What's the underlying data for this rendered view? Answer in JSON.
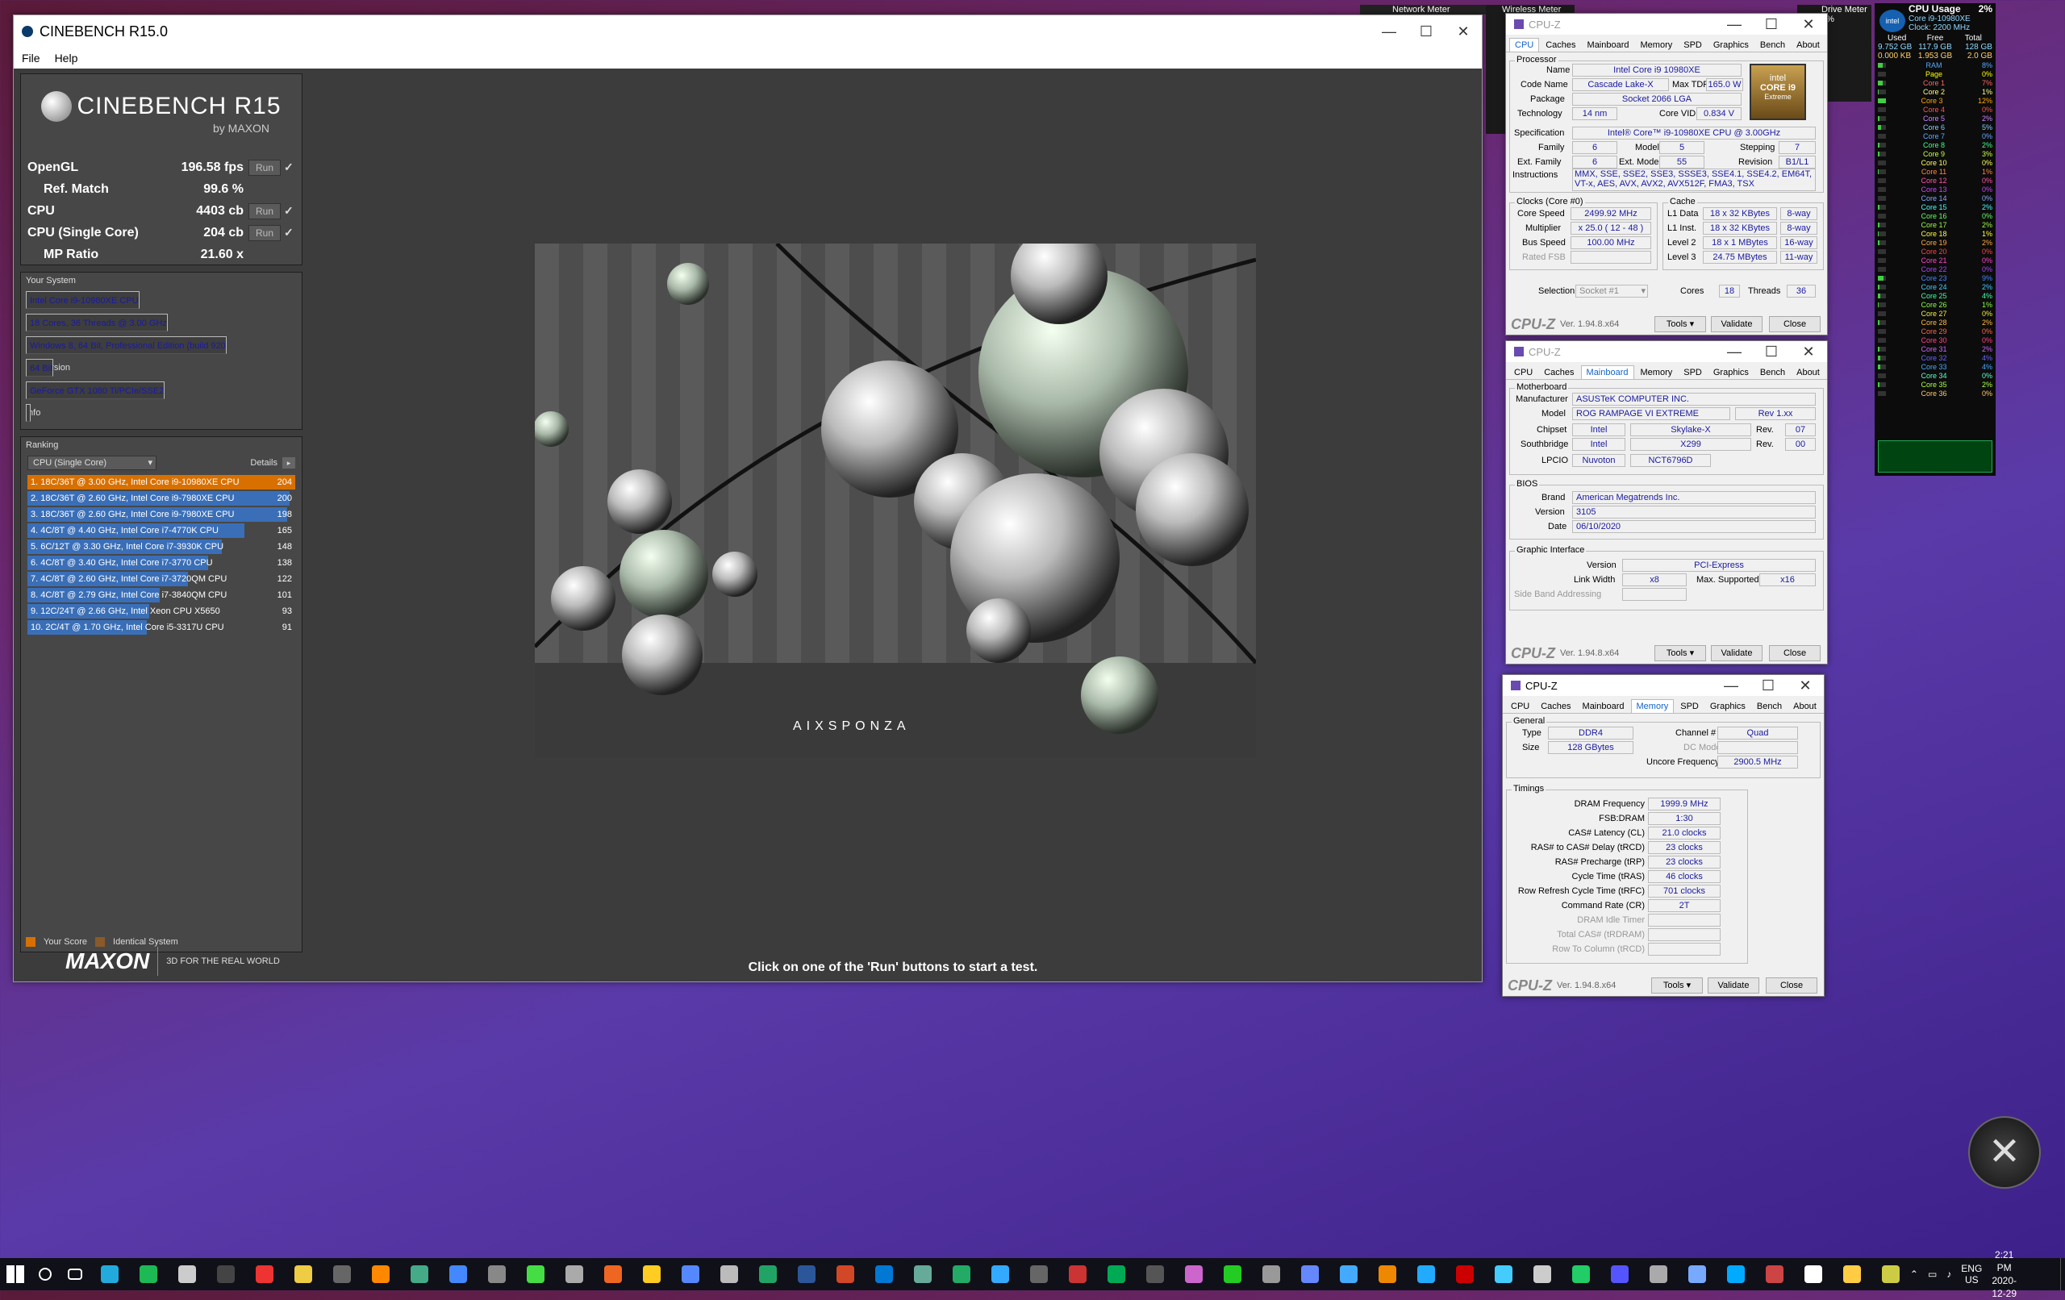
{
  "cinebench": {
    "title": "CINEBENCH R15.0",
    "menu": [
      "File",
      "Help"
    ],
    "logo_title": "CINEBENCH R15",
    "logo_sub": "by MAXON",
    "scores": [
      {
        "label": "OpenGL",
        "value": "196.58 fps",
        "run": "Run",
        "check": "✓"
      },
      {
        "label": "Ref. Match",
        "value": "99.6 %"
      },
      {
        "label": "CPU",
        "value": "4403 cb",
        "run": "Run",
        "check": "✓"
      },
      {
        "label": "CPU (Single Core)",
        "value": "204 cb",
        "run": "Run",
        "check": "✓"
      },
      {
        "label": "MP Ratio",
        "value": "21.60 x"
      }
    ],
    "system_header": "Your System",
    "system": [
      {
        "k": "Processor",
        "v": "Intel Core i9-10980XE CPU"
      },
      {
        "k": "Cores x GHz",
        "v": "18 Cores, 36 Threads @ 3.00 GHz"
      },
      {
        "k": "OS",
        "v": "Windows 8, 64 Bit, Professional Edition (build 920"
      },
      {
        "k": "CB Version",
        "v": "64 Bit"
      },
      {
        "k": "GFX Board",
        "v": "GeForce GTX 1080 Ti/PCIe/SSE2"
      },
      {
        "k": "Info",
        "v": ""
      }
    ],
    "ranking_header": "Ranking",
    "ranking_select": "CPU (Single Core)",
    "details_label": "Details",
    "ranking": [
      {
        "text": "1. 18C/36T @ 3.00 GHz, Intel Core i9-10980XE CPU",
        "score": 204,
        "color": "#d87000"
      },
      {
        "text": "2. 18C/36T @ 2.60 GHz, Intel Core i9-7980XE CPU",
        "score": 200,
        "color": "#3a6fb8"
      },
      {
        "text": "3. 18C/36T @ 2.60 GHz, Intel Core i9-7980XE CPU",
        "score": 198,
        "color": "#3a6fb8"
      },
      {
        "text": "4. 4C/8T @ 4.40 GHz, Intel Core i7-4770K CPU",
        "score": 165,
        "color": "#3a6fb8"
      },
      {
        "text": "5. 6C/12T @ 3.30 GHz,  Intel Core i7-3930K CPU",
        "score": 148,
        "color": "#3a6fb8"
      },
      {
        "text": "6. 4C/8T @ 3.40 GHz,  Intel Core i7-3770 CPU",
        "score": 138,
        "color": "#3a6fb8"
      },
      {
        "text": "7. 4C/8T @ 2.60 GHz, Intel Core i7-3720QM CPU",
        "score": 122,
        "color": "#3a6fb8"
      },
      {
        "text": "8. 4C/8T @ 2.79 GHz,  Intel Core i7-3840QM CPU",
        "score": 101,
        "color": "#3a6fb8"
      },
      {
        "text": "9. 12C/24T @ 2.66 GHz, Intel Xeon CPU X5650",
        "score": 93,
        "color": "#3a6fb8"
      },
      {
        "text": "10. 2C/4T @ 1.70 GHz,  Intel Core i5-3317U CPU",
        "score": 91,
        "color": "#3a6fb8"
      }
    ],
    "legend_your": "Your Score",
    "legend_identical": "Identical System",
    "maxon": "MAXON",
    "maxon_tag": "3D FOR THE REAL WORLD",
    "render_brand": "AIXSPONZA",
    "status": "Click on one of the 'Run' buttons to start a test."
  },
  "cpuz_common": {
    "brand": "CPU-Z",
    "version": "Ver. 1.94.8.x64",
    "tools": "Tools",
    "validate": "Validate",
    "close": "Close",
    "tabs": [
      "CPU",
      "Caches",
      "Mainboard",
      "Memory",
      "SPD",
      "Graphics",
      "Bench",
      "About"
    ]
  },
  "cpuz1": {
    "title": "CPU-Z",
    "processor": "Processor",
    "name_k": "Name",
    "name": "Intel Core i9 10980XE",
    "codename_k": "Code Name",
    "codename": "Cascade Lake-X",
    "maxtdp_k": "Max TDP",
    "maxtdp": "165.0 W",
    "package_k": "Package",
    "package": "Socket 2066 LGA",
    "tech_k": "Technology",
    "tech": "14 nm",
    "vid_k": "Core VID",
    "vid": "0.834 V",
    "spec_k": "Specification",
    "spec": "Intel® Core™ i9-10980XE CPU @ 3.00GHz",
    "family_k": "Family",
    "family": "6",
    "model_k": "Model",
    "model": "5",
    "stepping_k": "Stepping",
    "stepping": "7",
    "extfam_k": "Ext. Family",
    "extfam": "6",
    "extmodel_k": "Ext. Model",
    "extmodel": "55",
    "rev_k": "Revision",
    "rev": "B1/L1",
    "instr_k": "Instructions",
    "instr": "MMX, SSE, SSE2, SSE3, SSSE3, SSE4.1, SSE4.2, EM64T, VT-x, AES, AVX, AVX2, AVX512F, FMA3, TSX",
    "clocks": "Clocks (Core #0)",
    "cache": "Cache",
    "cs_k": "Core Speed",
    "cs": "2499.92 MHz",
    "mult_k": "Multiplier",
    "mult": "x 25.0 ( 12 - 48 )",
    "bus_k": "Bus Speed",
    "bus": "100.00 MHz",
    "fsb_k": "Rated FSB",
    "l1d_k": "L1 Data",
    "l1d": "18 x 32 KBytes",
    "l1d_w": "8-way",
    "l1i_k": "L1 Inst.",
    "l1i": "18 x 32 KBytes",
    "l1i_w": "8-way",
    "l2_k": "Level 2",
    "l2": "18 x 1 MBytes",
    "l2_w": "16-way",
    "l3_k": "Level 3",
    "l3": "24.75 MBytes",
    "l3_w": "11-way",
    "sel_k": "Selection",
    "sel": "Socket #1",
    "cores_k": "Cores",
    "cores": "18",
    "threads_k": "Threads",
    "threads": "36",
    "intel_logo": "intel",
    "intel_logo2": "CORE i9",
    "intel_logo3": "Extreme"
  },
  "cpuz2": {
    "title": "CPU-Z",
    "mb": "Motherboard",
    "manu_k": "Manufacturer",
    "manu": "ASUSTeK COMPUTER INC.",
    "model_k": "Model",
    "model": "ROG RAMPAGE VI EXTREME",
    "rev": "Rev 1.xx",
    "chip_k": "Chipset",
    "chip": "Intel",
    "chip2": "Skylake-X",
    "chiprev_k": "Rev.",
    "chiprev": "07",
    "sb_k": "Southbridge",
    "sb": "Intel",
    "sb2": "X299",
    "sbrev_k": "Rev.",
    "sbrev": "00",
    "lpcio_k": "LPCIO",
    "lpcio": "Nuvoton",
    "lpcio2": "NCT6796D",
    "bios": "BIOS",
    "brand_k": "Brand",
    "brand": "American Megatrends Inc.",
    "ver_k": "Version",
    "ver": "3105",
    "date_k": "Date",
    "date": "06/10/2020",
    "gi": "Graphic Interface",
    "giver_k": "Version",
    "giver": "PCI-Express",
    "lw_k": "Link Width",
    "lw": "x8",
    "ms_k": "Max. Supported",
    "ms": "x16",
    "sba_k": "Side Band Addressing"
  },
  "cpuz3": {
    "title": "CPU-Z",
    "general": "General",
    "type_k": "Type",
    "type": "DDR4",
    "ch_k": "Channel #",
    "ch": "Quad",
    "size_k": "Size",
    "size": "128 GBytes",
    "dc_k": "DC Mode",
    "unc_k": "Uncore Frequency",
    "unc": "2900.5 MHz",
    "timings": "Timings",
    "timing_rows": [
      {
        "k": "DRAM Frequency",
        "v": "1999.9 MHz"
      },
      {
        "k": "FSB:DRAM",
        "v": "1:30"
      },
      {
        "k": "CAS# Latency (CL)",
        "v": "21.0 clocks"
      },
      {
        "k": "RAS# to CAS# Delay (tRCD)",
        "v": "23 clocks"
      },
      {
        "k": "RAS# Precharge (tRP)",
        "v": "23 clocks"
      },
      {
        "k": "Cycle Time (tRAS)",
        "v": "46 clocks"
      },
      {
        "k": "Row Refresh Cycle Time (tRFC)",
        "v": "701 clocks"
      },
      {
        "k": "Command Rate (CR)",
        "v": "2T"
      },
      {
        "k": "DRAM Idle Timer",
        "v": ""
      },
      {
        "k": "Total CAS# (tRDRAM)",
        "v": ""
      },
      {
        "k": "Row To Column (tRCD)",
        "v": ""
      }
    ]
  },
  "gadget": {
    "title": "CPU Usage",
    "pct": "2%",
    "cpu": "Core i9-10980XE",
    "clock": "Clock: 2200 MHz",
    "h_used": "Used",
    "h_free": "Free",
    "h_total": "Total",
    "ram_used": "9.752 GB",
    "ram_free": "117.9 GB",
    "ram_total": "128 GB",
    "page_used": "0.000 KB",
    "page_free": "1.953 GB",
    "page_total": "2.0 GB",
    "rows": [
      {
        "n": "RAM",
        "p": "8%"
      },
      {
        "n": "Page",
        "p": "0%"
      },
      {
        "n": "Core 1",
        "p": "7%"
      },
      {
        "n": "Core 2",
        "p": "1%"
      },
      {
        "n": "Core 3",
        "p": "12%"
      },
      {
        "n": "Core 4",
        "p": "0%"
      },
      {
        "n": "Core 5",
        "p": "2%"
      },
      {
        "n": "Core 6",
        "p": "5%"
      },
      {
        "n": "Core 7",
        "p": "0%"
      },
      {
        "n": "Core 8",
        "p": "2%"
      },
      {
        "n": "Core 9",
        "p": "3%"
      },
      {
        "n": "Core 10",
        "p": "0%"
      },
      {
        "n": "Core 11",
        "p": "1%"
      },
      {
        "n": "Core 12",
        "p": "0%"
      },
      {
        "n": "Core 13",
        "p": "0%"
      },
      {
        "n": "Core 14",
        "p": "0%"
      },
      {
        "n": "Core 15",
        "p": "2%"
      },
      {
        "n": "Core 16",
        "p": "0%"
      },
      {
        "n": "Core 17",
        "p": "2%"
      },
      {
        "n": "Core 18",
        "p": "1%"
      },
      {
        "n": "Core 19",
        "p": "2%"
      },
      {
        "n": "Core 20",
        "p": "0%"
      },
      {
        "n": "Core 21",
        "p": "0%"
      },
      {
        "n": "Core 22",
        "p": "0%"
      },
      {
        "n": "Core 23",
        "p": "9%"
      },
      {
        "n": "Core 24",
        "p": "2%"
      },
      {
        "n": "Core 25",
        "p": "4%"
      },
      {
        "n": "Core 26",
        "p": "1%"
      },
      {
        "n": "Core 27",
        "p": "0%"
      },
      {
        "n": "Core 28",
        "p": "2%"
      },
      {
        "n": "Core 29",
        "p": "0%"
      },
      {
        "n": "Core 30",
        "p": "0%"
      },
      {
        "n": "Core 31",
        "p": "2%"
      },
      {
        "n": "Core 32",
        "p": "4%"
      },
      {
        "n": "Core 33",
        "p": "4%"
      },
      {
        "n": "Core 34",
        "p": "0%"
      },
      {
        "n": "Core 35",
        "p": "2%"
      },
      {
        "n": "Core 36",
        "p": "0%"
      }
    ]
  },
  "behind": {
    "wireless": "Wireless Meter",
    "network": "Network Meter",
    "drive": "Drive Meter",
    "drive_pct": "0%"
  },
  "tray": {
    "lang": "ENG",
    "region": "US",
    "time": "2:21 PM",
    "date": "2020-12-29"
  }
}
